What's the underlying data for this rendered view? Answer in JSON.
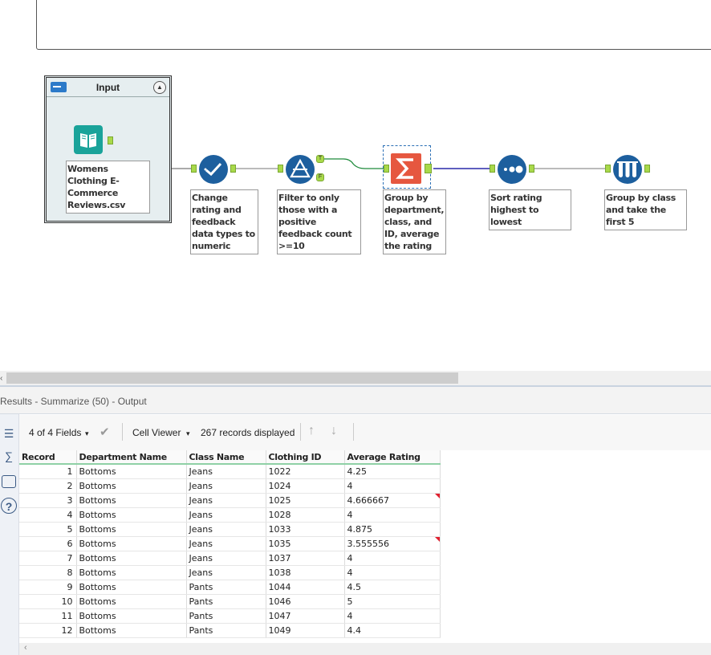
{
  "canvas": {
    "container": {
      "title": "Input",
      "collapse_icon": "chevron-up-icon"
    },
    "tools": [
      {
        "id": "input",
        "icon": "book-icon",
        "label": "Womens Clothing E-Commerce Reviews.csv",
        "color": "#1aa39a"
      },
      {
        "id": "select",
        "icon": "checkmark-icon",
        "label": "Change rating and feedback data types to numeric",
        "color": "#1d5f9e"
      },
      {
        "id": "filter",
        "icon": "filter-icon",
        "label": "Filter to only those with a positive feedback count >=10",
        "color": "#1d5f9e"
      },
      {
        "id": "summarize",
        "icon": "sigma-icon",
        "label": "Group by department, class, and ID, average the rating",
        "color": "#e6573f"
      },
      {
        "id": "sort",
        "icon": "sort-icon",
        "label": "Sort rating highest to lowest",
        "color": "#1d5f9e"
      },
      {
        "id": "sample",
        "icon": "sample-icon",
        "label": "Group by class and take the first 5",
        "color": "#1d5f9e"
      }
    ],
    "filter_anchors": {
      "true": "T",
      "false": "F"
    }
  },
  "results": {
    "title": "Results - Summarize (50) - Output",
    "fields_selector": "4 of 4 Fields",
    "viewer": "Cell Viewer",
    "records_displayed": "267 records displayed",
    "columns": [
      "Record",
      "Department Name",
      "Class Name",
      "Clothing ID",
      "Average Rating"
    ],
    "rows": [
      [
        "1",
        "Bottoms",
        "Jeans",
        "1022",
        "4.25"
      ],
      [
        "2",
        "Bottoms",
        "Jeans",
        "1024",
        "4"
      ],
      [
        "3",
        "Bottoms",
        "Jeans",
        "1025",
        "4.666667"
      ],
      [
        "4",
        "Bottoms",
        "Jeans",
        "1028",
        "4"
      ],
      [
        "5",
        "Bottoms",
        "Jeans",
        "1033",
        "4.875"
      ],
      [
        "6",
        "Bottoms",
        "Jeans",
        "1035",
        "3.555556"
      ],
      [
        "7",
        "Bottoms",
        "Jeans",
        "1037",
        "4"
      ],
      [
        "8",
        "Bottoms",
        "Jeans",
        "1038",
        "4"
      ],
      [
        "9",
        "Bottoms",
        "Pants",
        "1044",
        "4.5"
      ],
      [
        "10",
        "Bottoms",
        "Pants",
        "1046",
        "5"
      ],
      [
        "11",
        "Bottoms",
        "Pants",
        "1047",
        "4"
      ],
      [
        "12",
        "Bottoms",
        "Pants",
        "1049",
        "4.4"
      ]
    ],
    "truncated_rows": [
      2,
      5
    ]
  }
}
